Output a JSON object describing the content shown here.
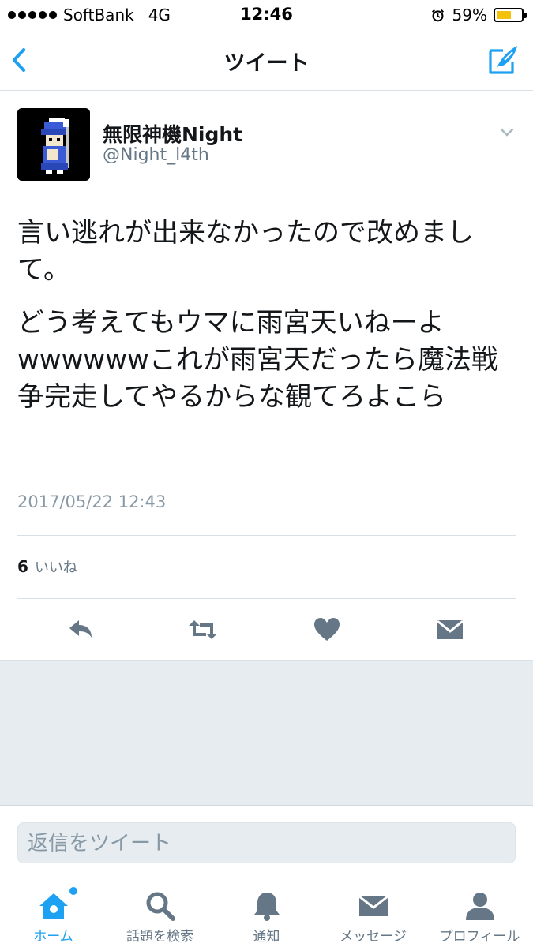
{
  "status_bar": {
    "carrier": "SoftBank",
    "network": "4G",
    "time": "12:46",
    "battery_text": "59%",
    "battery_level": 0.59,
    "icons": [
      "signal-dots-icon",
      "alarm-icon",
      "battery-icon"
    ]
  },
  "nav": {
    "title": "ツイート",
    "back_icon": "chevron-left-icon",
    "compose_icon": "compose-tweet-icon"
  },
  "tweet": {
    "author_name": "無限神機Night",
    "author_handle": "@Night_l4th",
    "text_p1": "言い逃れが出来なかったので改めまして。",
    "text_p2": "どう考えてもウマに雨宮天いねーよwwwwwwこれが雨宮天だったら魔法戦争完走してやるからな観てろよこら",
    "timestamp": "2017/05/22 12:43",
    "likes_count": "6",
    "likes_label": "いいね"
  },
  "actions": [
    "reply-icon",
    "retweet-icon",
    "like-heart-icon",
    "direct-message-icon"
  ],
  "reply": {
    "placeholder": "返信をツイート"
  },
  "tabs": [
    {
      "label": "ホーム",
      "icon": "home-icon",
      "active": true
    },
    {
      "label": "話題を検索",
      "icon": "search-icon"
    },
    {
      "label": "通知",
      "icon": "bell-icon"
    },
    {
      "label": "メッセージ",
      "icon": "envelope-icon"
    },
    {
      "label": "プロフィール",
      "icon": "person-icon"
    }
  ],
  "colors": {
    "accent": "#1da1f2",
    "text": "#14171a",
    "secondary": "#657786",
    "divider": "#d8dfe5",
    "battery": "#f4c20d"
  }
}
